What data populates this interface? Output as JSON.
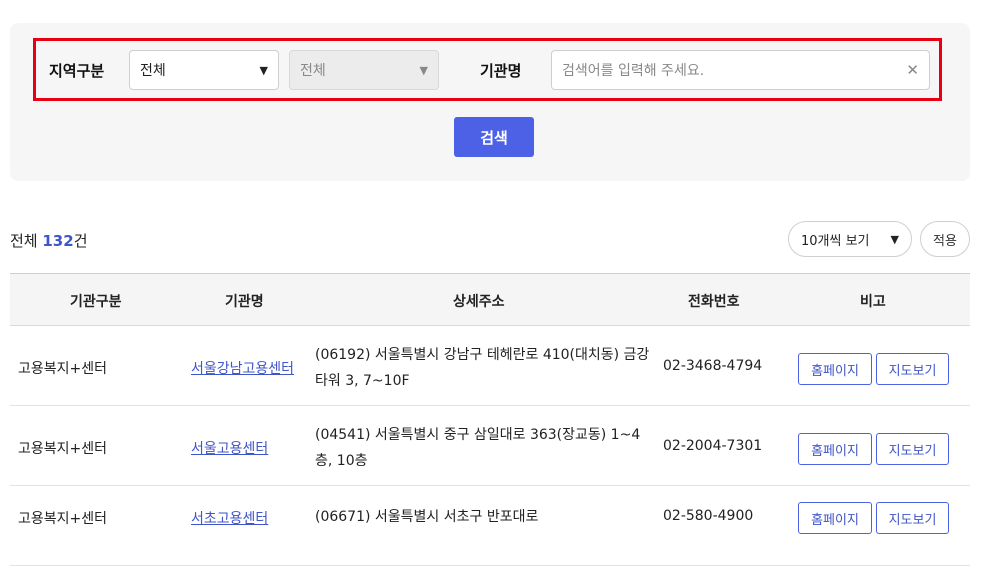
{
  "search": {
    "region_label": "지역구분",
    "region_select": "전체",
    "subregion_select": "전체",
    "org_label": "기관명",
    "org_placeholder": "검색어를 입력해 주세요.",
    "search_button": "검색"
  },
  "results": {
    "total_prefix": "전체 ",
    "total_count": "132",
    "total_suffix": "건",
    "page_size": "10개씩 보기",
    "apply_button": "적용"
  },
  "table": {
    "headers": [
      "기관구분",
      "기관명",
      "상세주소",
      "전화번호",
      "비고"
    ],
    "rows": [
      {
        "type": "고용복지+센터",
        "name": "서울강남고용센터",
        "address": "(06192) 서울특별시 강남구 테헤란로 410(대치동) 금강타워 3, 7~10F",
        "phone": "02-3468-4794",
        "homepage": "홈페이지",
        "map": "지도보기"
      },
      {
        "type": "고용복지+센터",
        "name": "서울고용센터",
        "address": "(04541) 서울특별시 중구 삼일대로 363(장교동) 1~4층, 10층",
        "phone": "02-2004-7301",
        "homepage": "홈페이지",
        "map": "지도보기"
      },
      {
        "type": "고용복지+센터",
        "name": "서초고용센터",
        "address": "(06671) 서울특별시 서초구 반포대로",
        "phone": "02-580-4900",
        "homepage": "홈페이지",
        "map": "지도보기"
      }
    ]
  }
}
